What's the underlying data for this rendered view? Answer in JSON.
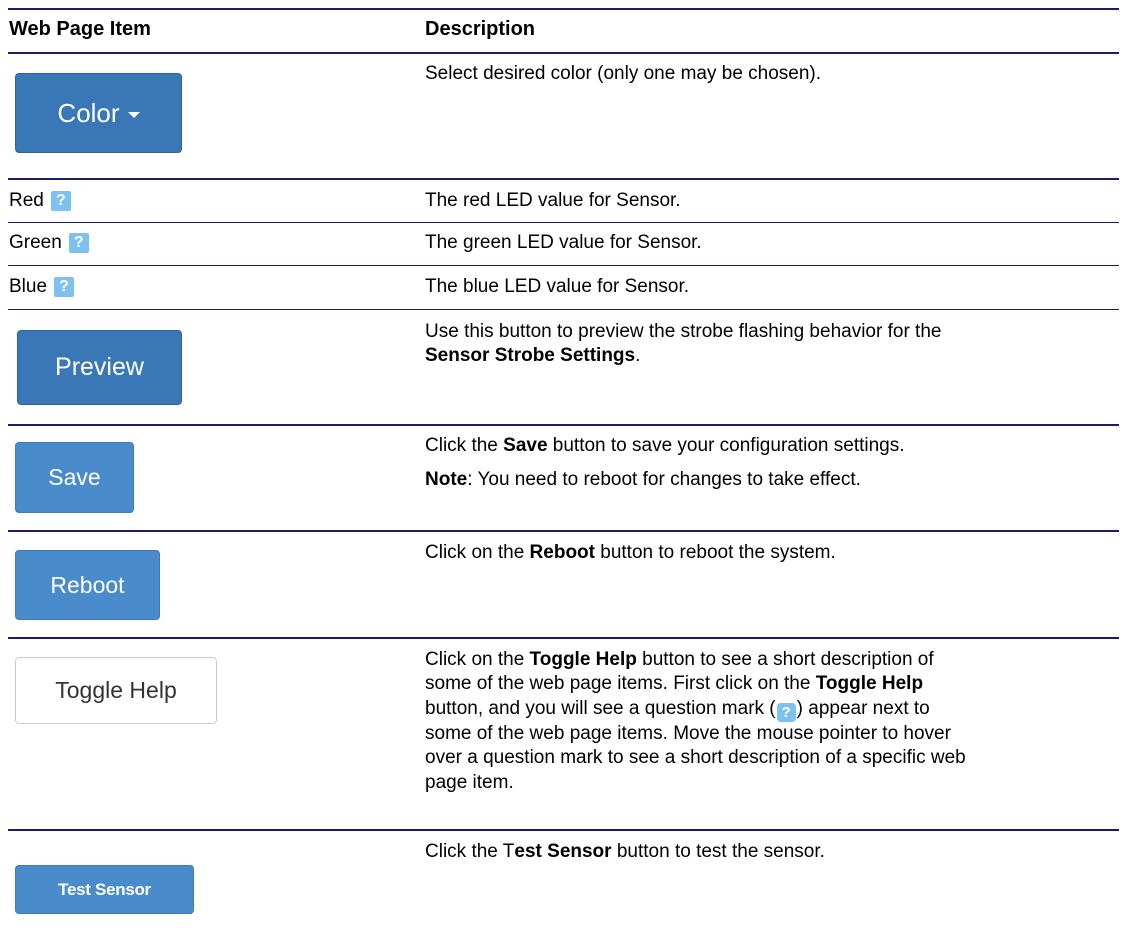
{
  "header": {
    "item_col": "Web Page Item",
    "desc_col": "Description"
  },
  "rows": [
    {
      "item_label": "Color",
      "icon": "caret-down-icon",
      "desc": [
        "Select desired color (only one may be chosen)."
      ]
    },
    {
      "item_label": "Red",
      "help_icon": "?",
      "desc": [
        "The red LED value for Sensor."
      ]
    },
    {
      "item_label": "Green",
      "help_icon": "?",
      "desc": [
        "The green LED value for Sensor."
      ]
    },
    {
      "item_label": "Blue",
      "help_icon": "?",
      "desc": [
        "The blue LED value for Sensor."
      ]
    },
    {
      "item_label": "Preview",
      "desc_line1": "Use this button to preview the strobe flashing behavior for the",
      "desc_bold": "Sensor Strobe Settings",
      "desc_end": "."
    },
    {
      "item_label": "Save",
      "desc_pre": "Click the ",
      "desc_bold": "Save",
      "desc_post": " button to save your configuration settings.",
      "note_bold": "Note",
      "note_text": ": You need to reboot for changes to take effect."
    },
    {
      "item_label": "Reboot",
      "desc_pre": "Click on the ",
      "desc_bold": "Reboot",
      "desc_post": " button to reboot the system."
    },
    {
      "item_label": "Toggle Help",
      "desc_l1_pre": "Click on the ",
      "desc_l1_bold": "Toggle Help",
      "desc_l1_post": " button to see a short description of",
      "desc_l2_pre": "some of the web page items. First click on the ",
      "desc_l2_bold": "Toggle Help",
      "desc_l3_pre": "button, and you will see a question mark (",
      "desc_l3_icon": "?",
      "desc_l3_post": ") appear next to",
      "desc_l4": "some of the web page items. Move the mouse pointer to hover",
      "desc_l5": "over a question mark to see a short description of a specific web",
      "desc_l6": "page item."
    },
    {
      "item_label": "Test Sensor",
      "desc_pre": "Click the T",
      "desc_bold": "est Sensor",
      "desc_post": " button to test the sensor."
    }
  ],
  "colors": {
    "rule": "#1a1a6e",
    "button_dark": "#3a77b7",
    "button_light": "#4a8bcb",
    "help_icon_bg": "#7ec0f0"
  }
}
